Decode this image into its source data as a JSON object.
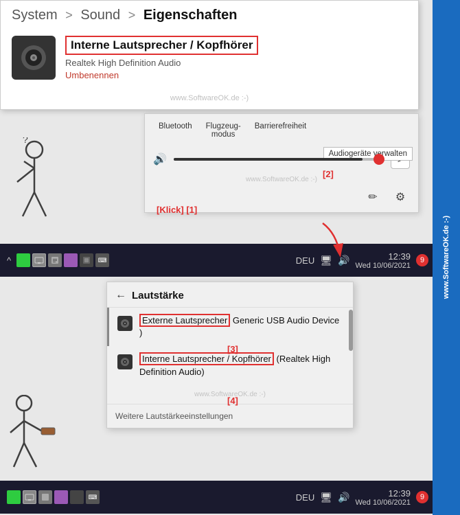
{
  "breadcrumb": {
    "system": "System",
    "sep1": ">",
    "sound": "Sound",
    "sep2": ">",
    "properties": "Eigenschaften"
  },
  "device": {
    "name": "Interne Lautsprecher / Kopfhörer",
    "subtitle": "Realtek High Definition Audio",
    "rename": "Umbenennen"
  },
  "settings": {
    "tabs": [
      "Bluetooth",
      "Flugzeug-\nmodus",
      "Barriere­freiheit"
    ],
    "manage_label": "Audiogeräte verwalten",
    "volume_icon": "🔊",
    "arrow_label": ">"
  },
  "labels": {
    "label1": "[Klick] [1]",
    "label2": "[2]",
    "label3": "[3]",
    "label4": "[4]"
  },
  "taskbar": {
    "lang": "DEU",
    "time": "12:39",
    "date": "Wed 10/06/2021",
    "badge": "9"
  },
  "flyout": {
    "back": "←",
    "title": "Lautstärke",
    "item1_label": "Externe Lautsprecher",
    "item1_rest": " Generic USB Audio Device )",
    "item2_label": "Interne Lautsprecher / Kopfhörer",
    "item2_rest": " (Realtek High Definition Audio)",
    "footer": "Weitere Lautstärkeeinstellungen"
  },
  "watermark": {
    "text": "www.SoftwareOK.de :-)"
  },
  "mid_watermark": "www.SoftwareOK.de :-)",
  "icons": {
    "pencil": "✏",
    "gear": "⚙",
    "speaker": "🔊"
  }
}
